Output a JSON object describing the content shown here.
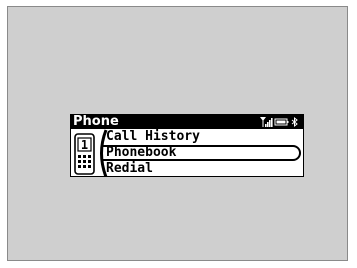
{
  "screen": {
    "title": "Phone",
    "status_icons": [
      "signal-icon",
      "battery-icon",
      "bluetooth-icon"
    ],
    "menu": {
      "items": [
        {
          "label": "Call History"
        },
        {
          "label": "Phonebook",
          "selected": true
        },
        {
          "label": "Redial"
        }
      ]
    },
    "phone_icon_digit": "1"
  },
  "colors": {
    "panel_bg": "#cfcfcf",
    "lcd_bg": "#ffffff",
    "lcd_fg": "#000000"
  }
}
